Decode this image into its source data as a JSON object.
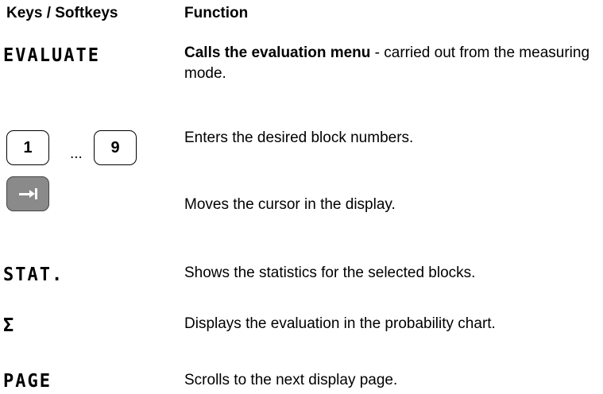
{
  "headers": {
    "keys": "Keys / Softkeys",
    "function": "Function"
  },
  "rows": [
    {
      "key": "EVALUATE",
      "function_bold": "Calls the evaluation menu",
      "function_rest": " - carried out from the measuring mode."
    },
    {
      "key_first": "1",
      "key_ellipsis": "...",
      "key_last": "9",
      "function": "Enters the desired block numbers."
    },
    {
      "key_icon": "tab-arrow-icon",
      "function": "Moves the cursor in the display."
    },
    {
      "key": "STAT.",
      "function": "Shows the statistics for the selected blocks."
    },
    {
      "key": "Σ",
      "function": "Displays the evaluation in the probability chart."
    },
    {
      "key": "PAGE",
      "function": "Scrolls to the next display page."
    }
  ]
}
